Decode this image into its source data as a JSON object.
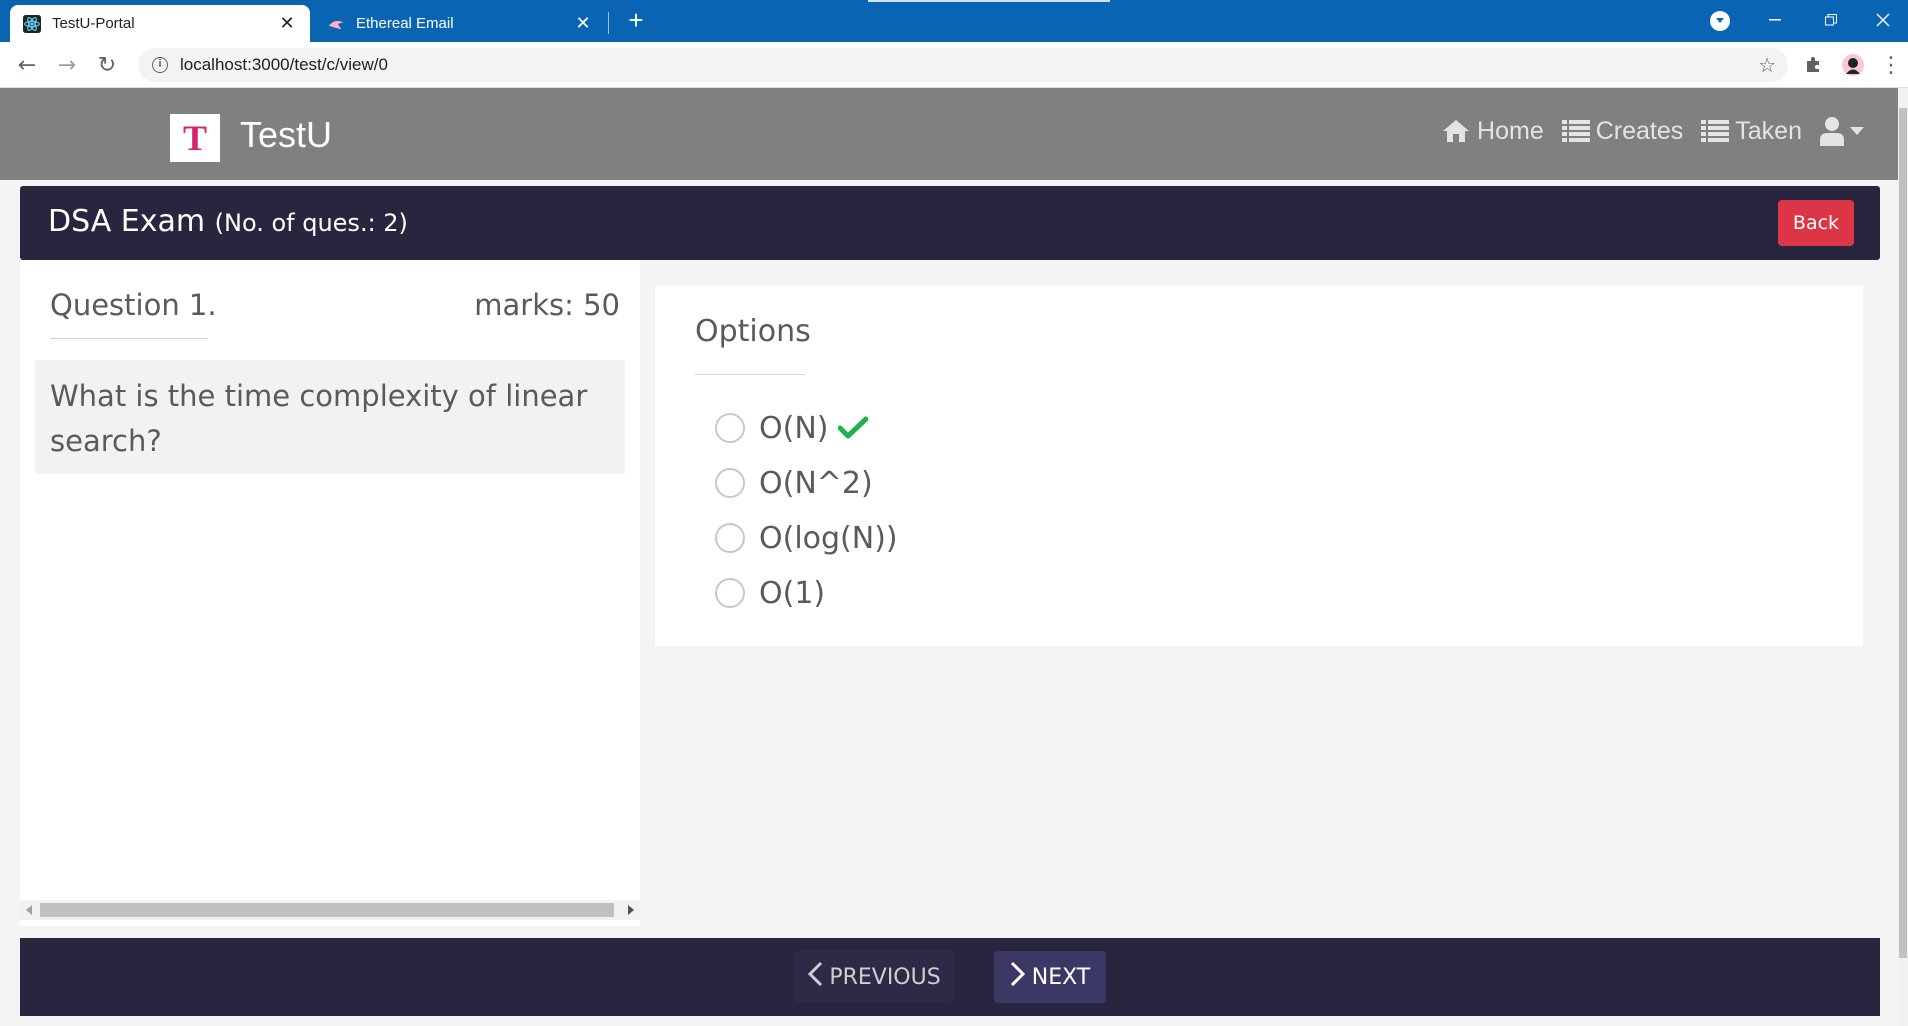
{
  "browser": {
    "tabs": [
      {
        "title": "TestU-Portal",
        "active": true
      },
      {
        "title": "Ethereal Email",
        "active": false
      }
    ],
    "url": "localhost:3000/test/c/view/0"
  },
  "navbar": {
    "brand_letter": "T",
    "brand_name": "TestU",
    "links": [
      {
        "label": "Home",
        "icon": "home-icon"
      },
      {
        "label": "Creates",
        "icon": "list-icon"
      },
      {
        "label": "Taken",
        "icon": "list-icon"
      }
    ],
    "user_icon": "user-icon"
  },
  "exam": {
    "title": "DSA Exam",
    "subtitle": "(No. of ques.: 2)",
    "back_label": "Back"
  },
  "question": {
    "label": "Question 1.",
    "marks": "marks: 50",
    "text": "What is the time complexity of linear search?"
  },
  "options": {
    "title": "Options",
    "items": [
      {
        "label": "O(N)",
        "correct": true
      },
      {
        "label": "O(N^2)",
        "correct": false
      },
      {
        "label": "O(log(N))",
        "correct": false
      },
      {
        "label": "O(1)",
        "correct": false
      }
    ]
  },
  "pager": {
    "previous_label": "PREVIOUS",
    "next_label": "NEXT"
  },
  "colors": {
    "header_bg": "#28253f",
    "navbar_bg": "#808080",
    "back_button": "#dc3545",
    "correct_check": "#21b14b"
  }
}
